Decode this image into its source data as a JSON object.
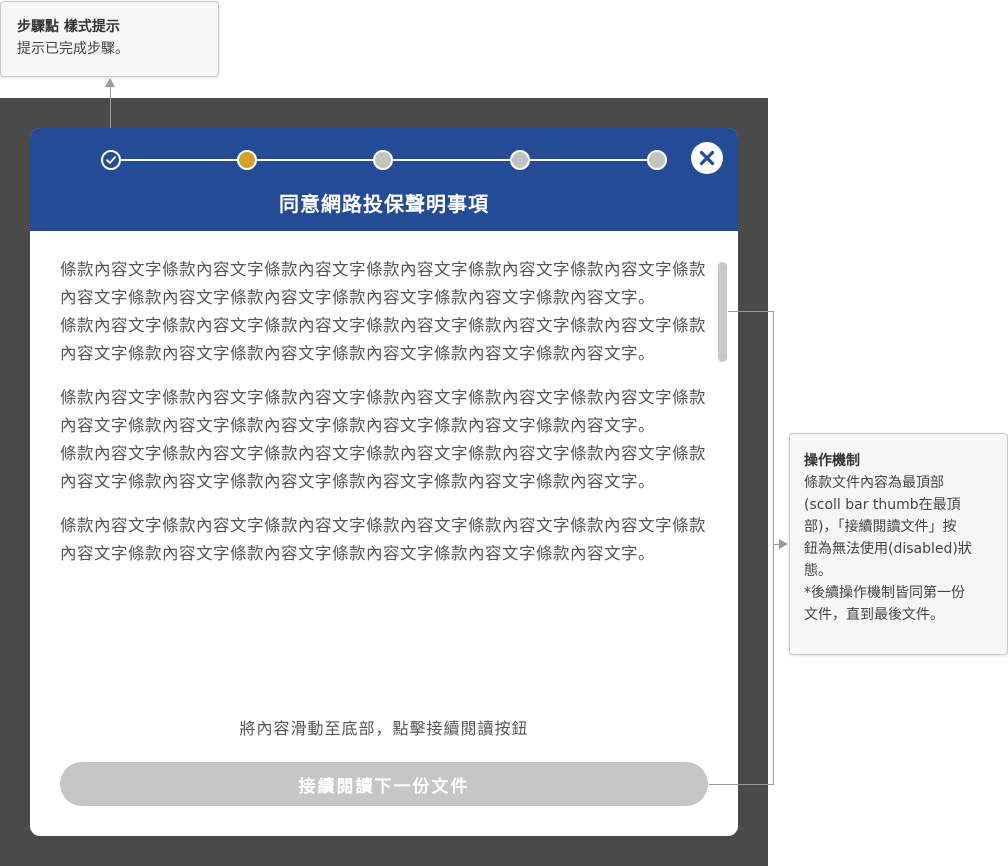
{
  "annotations": {
    "step": {
      "title": "步驟點 樣式提示",
      "body": "提示已完成步驟。"
    },
    "operation": {
      "title": "操作機制",
      "body": "條款文件內容為最頂部\n(scoll bar thumb在最頂\n部)，「接續閱讀文件」按\n鈕為無法使用(disabled)狀\n態。\n*後續操作機制皆同第一份\n文件，直到最後文件。"
    }
  },
  "modal": {
    "title": "同意網路投保聲明事項",
    "close_icon": "close-icon",
    "steps": [
      {
        "state": "done"
      },
      {
        "state": "current"
      },
      {
        "state": "todo"
      },
      {
        "state": "todo"
      },
      {
        "state": "todo"
      }
    ],
    "content": {
      "paragraphs": [
        "條款內容文字條款內容文字條款內容文字條款內容文字條款內容文字條款內容文字條款內容文字條款內容文字條款內容文字條款內容文字條款內容文字條款內容文字。\n條款內容文字條款內容文字條款內容文字條款內容文字條款內容文字條款內容文字條款內容文字條款內容文字條款內容文字條款內容文字條款內容文字條款內容文字。",
        "條款內容文字條款內容文字條款內容文字條款內容文字條款內容文字條款內容文字條款內容文字條款內容文字條款內容文字條款內容文字條款內容文字條款內容文字。\n條款內容文字條款內容文字條款內容文字條款內容文字條款內容文字條款內容文字條款內容文字條款內容文字條款內容文字條款內容文字條款內容文字條款內容文字。",
        "條款內容文字條款內容文字條款內容文字條款內容文字條款內容文字條款內容文字條款內容文字條款內容文字條款內容文字條款內容文字條款內容文字條款內容文字。"
      ]
    },
    "hint": "將內容滑動至底部，點擊接續閱讀按鈕",
    "continue_button": {
      "label": "接續閱讀下一份文件",
      "disabled": true
    }
  },
  "colors": {
    "header": "#244b95",
    "step_current": "#d7a12c",
    "step_todo": "#c3c3c3",
    "button_disabled": "#c6c6c6",
    "backdrop": "#4a4a4a"
  }
}
